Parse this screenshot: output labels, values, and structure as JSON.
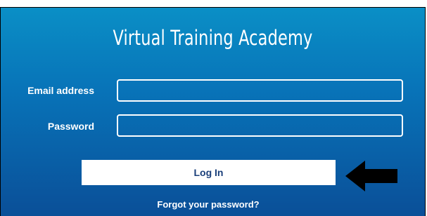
{
  "login": {
    "title": "Virtual Training Academy",
    "email_label": "Email address",
    "email_value": "",
    "password_label": "Password",
    "password_value": "",
    "login_button": "Log In",
    "forgot_link": "Forgot your password?"
  },
  "colors": {
    "background_top": "#0a8fc6",
    "background_bottom": "#0a4f98",
    "button_text": "#1a3f7a",
    "arrow": "#000000"
  },
  "icons": {
    "annotation_arrow": "left-arrow-icon"
  }
}
